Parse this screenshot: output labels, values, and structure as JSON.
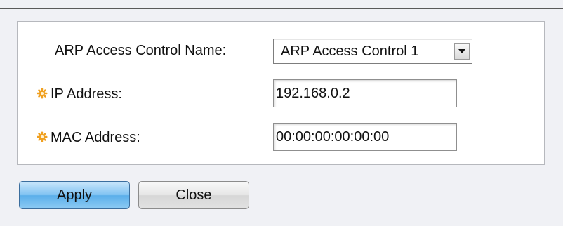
{
  "form": {
    "arp_name_label": "ARP Access Control Name:",
    "arp_name_selected": "ARP Access Control 1",
    "ip_label": "IP Address:",
    "ip_value": "192.168.0.2",
    "mac_label": "MAC Address:",
    "mac_value": "00:00:00:00:00:00",
    "required_icon": "gear-asterisk-icon",
    "required_color": "#f0a020"
  },
  "buttons": {
    "apply_label": "Apply",
    "close_label": "Close"
  },
  "colors": {
    "apply_accent": "#5aaeea",
    "background": "#f0f1f5"
  }
}
